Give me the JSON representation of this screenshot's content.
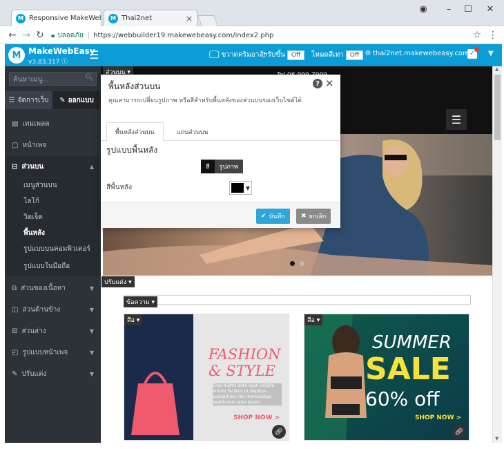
{
  "browser": {
    "tabs": [
      {
        "label": "Responsive MakeWebEas",
        "close": "×"
      },
      {
        "label": "Thai2net",
        "close": "×"
      }
    ],
    "window_controls": {
      "profile": "◉",
      "minimize": "–",
      "maximize": "☐",
      "close": "✕"
    },
    "secure_label": "ปลอดภัย",
    "url": "https://webbuilder19.makewebeasy.com/index2.php"
  },
  "app_header": {
    "brand": "MakeWebEasy",
    "version": "v3.83.317",
    "preview_label": "ขวาดคริมอาล์ฯ",
    "fullwidth_label": "รับขึ้น",
    "fullwidth_toggle": "Off",
    "dark_mode_label": "โหมดสีเทา",
    "dark_mode_toggle": "Off",
    "domain": "thai2net.makewebeasy.com",
    "accent_color": "#0c9dd7"
  },
  "sidebar": {
    "search_placeholder": "ค้นหาเมนู...",
    "tab_manage": "จัดการเว็บ",
    "tab_design": "ออกแบบ",
    "items": [
      {
        "label": "เทมเพลต",
        "icon": "template-icon"
      },
      {
        "label": "หน้าเพจ",
        "icon": "page-icon"
      },
      {
        "label": "ส่วนบน",
        "icon": "header-section-icon"
      }
    ],
    "sub_items": [
      {
        "label": "เมนูส่วนบน"
      },
      {
        "label": "โลโก้"
      },
      {
        "label": "วิดเจ็ต"
      },
      {
        "label": "พื้นหลัง"
      },
      {
        "label": "รูปแบบบนคอมพิวเตอร์"
      },
      {
        "label": "รูปแบบในมือถือ"
      }
    ],
    "more_items": [
      {
        "label": "ส่วนของเนื้อหา"
      },
      {
        "label": "ส่วนด้านข้าง"
      },
      {
        "label": "ส่วนล่าง"
      },
      {
        "label": "รูปแบบหน้าเพจ"
      },
      {
        "label": "ปรับแต่ง"
      }
    ]
  },
  "canvas": {
    "header_tag": "ส่วนบน ▾",
    "phone_text": "Tel 08-999-7999",
    "adjust_tag": "ปรับแต่ง ▾",
    "section_tag": "ข้อความ ▾",
    "image_tag": "สีอ ▾",
    "promo1": {
      "title1": "FASHION",
      "title2": "& STYLE",
      "body": "Cras mattis ante eget condim entum facilisis.Ut dapibus suscipit leo nec rhoncusdapi. Vestibulum ante ipsum.",
      "cta": "SHOP NOW >"
    },
    "promo2": {
      "title1": "SUMMER",
      "title2": "SALE",
      "title3": "60% off",
      "cta": "SHOP NOW >"
    }
  },
  "modal": {
    "title": "พื้นหลังส่วนบน",
    "description": "คุณสามารถเปลี่ยนรูปภาพ หรือสีสำหรับพื้นหลังของส่วนบนของเว็บไซต์ได้",
    "tabs": [
      "พื้นหลังส่วนบน",
      "แถบส่วนบน"
    ],
    "bg_style_heading": "รูปแบบพื้นหลัง",
    "segment_color": "สี",
    "segment_image": "รูปภาพ",
    "bg_color_label": "สีพื้นหลัง",
    "bg_color_value": "#000000",
    "save_label": "บันทึก",
    "cancel_label": "ยกเลิก",
    "save_color": "#2ea6d9",
    "cancel_color": "#8a8a8a"
  }
}
